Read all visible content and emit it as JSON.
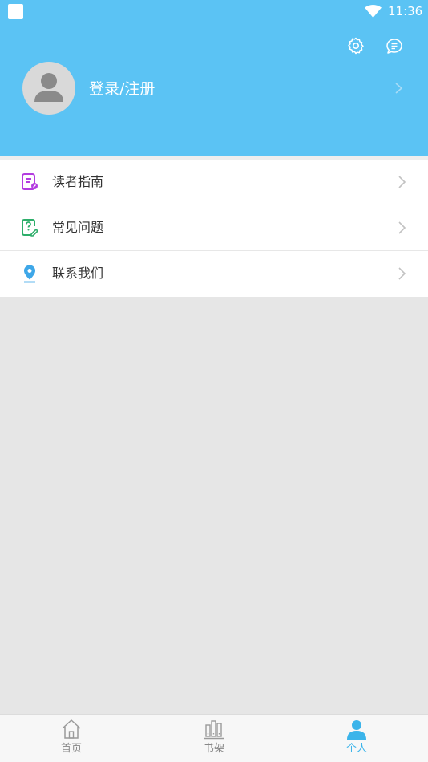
{
  "status": {
    "time": "11:36"
  },
  "profile": {
    "login_label": "登录/注册"
  },
  "menu": [
    {
      "label": "读者指南",
      "icon": "reader-guide-icon",
      "color": "#b33ce0"
    },
    {
      "label": "常见问题",
      "icon": "faq-icon",
      "color": "#2dae6a"
    },
    {
      "label": "联系我们",
      "icon": "location-pin-icon",
      "color": "#3ea7e8"
    }
  ],
  "tabs": [
    {
      "label": "首页",
      "icon": "home-icon",
      "active": false
    },
    {
      "label": "书架",
      "icon": "bookshelf-icon",
      "active": false
    },
    {
      "label": "个人",
      "icon": "person-icon",
      "active": true
    }
  ],
  "colors": {
    "header": "#5bc3f4",
    "accent": "#3bb4ea"
  }
}
